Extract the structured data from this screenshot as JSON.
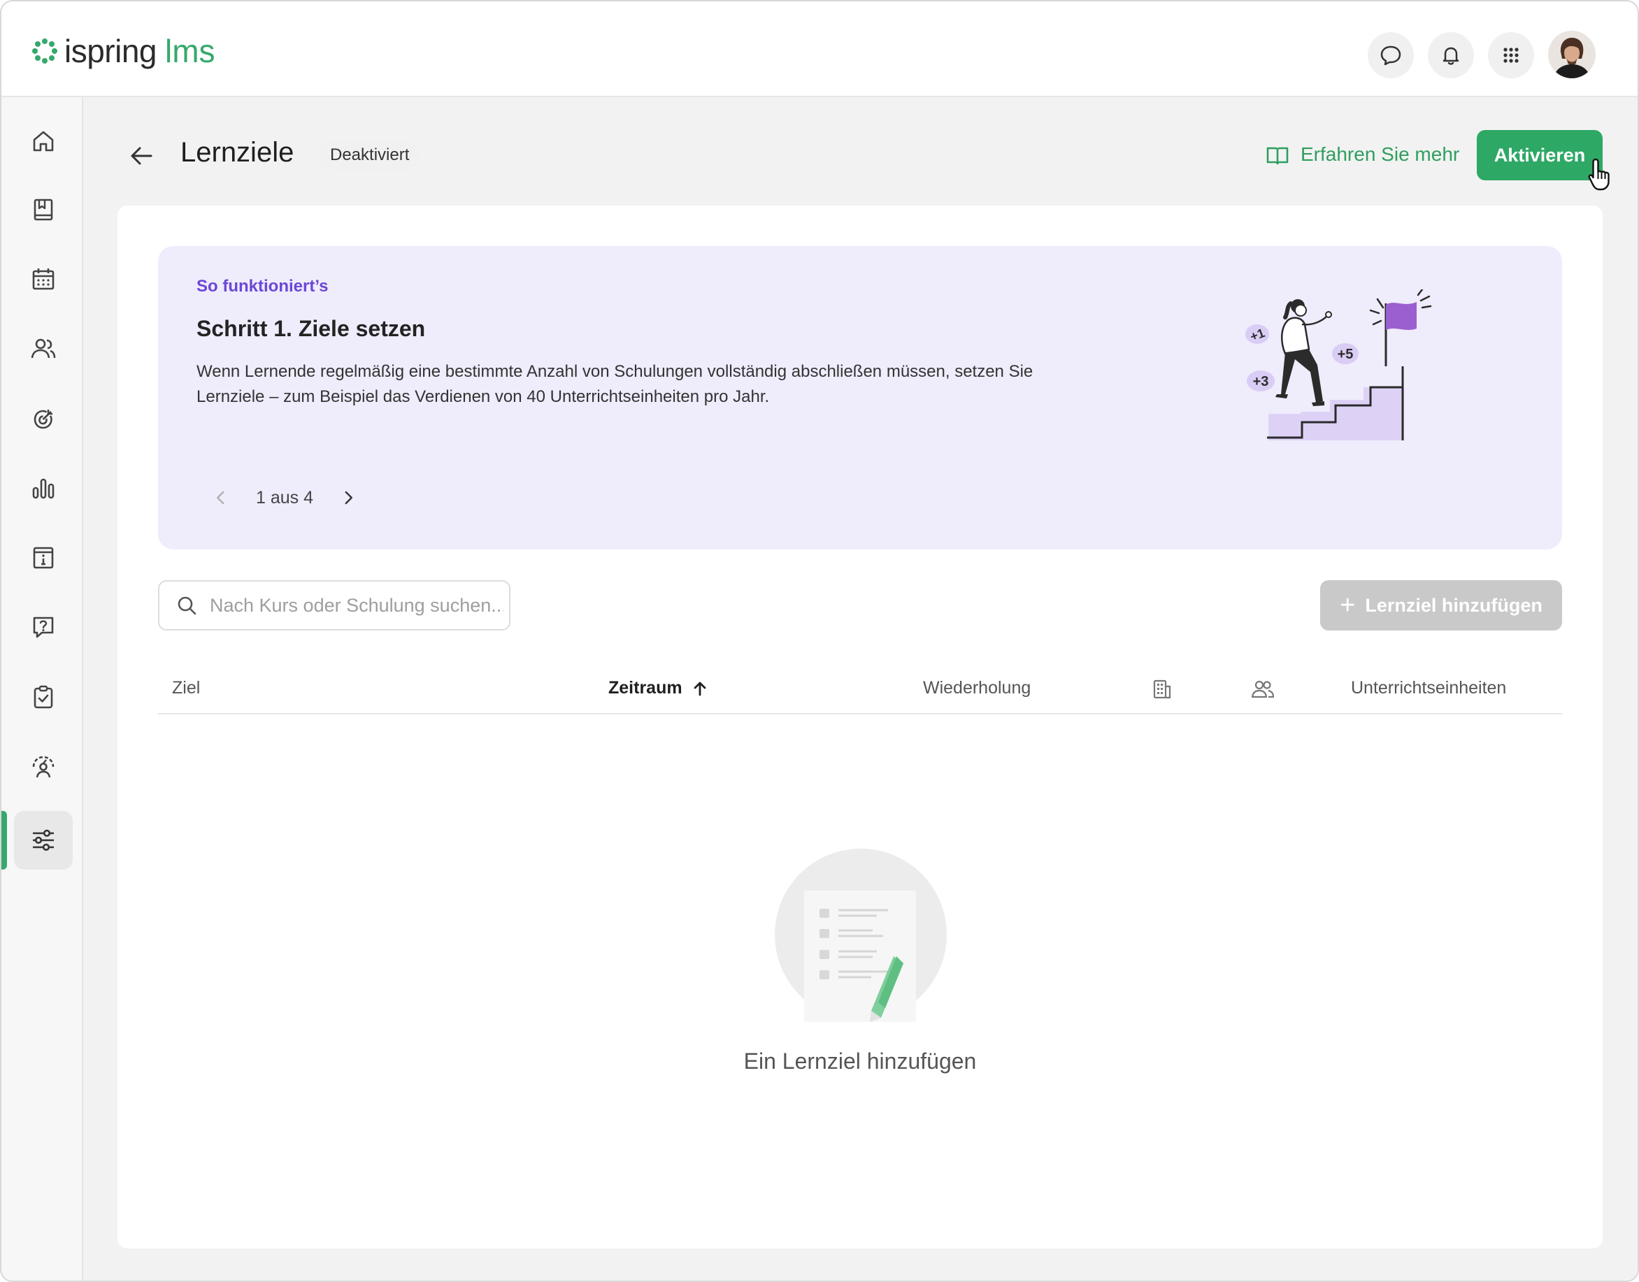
{
  "header": {
    "logo_text": "ispring",
    "logo_suffix": "lms",
    "icons": [
      "chat-icon",
      "bell-icon",
      "apps-grid-icon",
      "user-avatar"
    ]
  },
  "sidebar": {
    "items": [
      {
        "name": "home",
        "icon": "home-icon",
        "active": false
      },
      {
        "name": "learning",
        "icon": "book-icon",
        "active": false
      },
      {
        "name": "calendar",
        "icon": "calendar-icon",
        "active": false
      },
      {
        "name": "users",
        "icon": "users-icon",
        "active": false
      },
      {
        "name": "goals",
        "icon": "target-icon",
        "active": false
      },
      {
        "name": "reports",
        "icon": "bar-chart-icon",
        "active": false
      },
      {
        "name": "info",
        "icon": "info-icon",
        "active": false
      },
      {
        "name": "help",
        "icon": "question-icon",
        "active": false
      },
      {
        "name": "tasks",
        "icon": "clipboard-check-icon",
        "active": false
      },
      {
        "name": "performance",
        "icon": "gauge-user-icon",
        "active": false
      },
      {
        "name": "settings",
        "icon": "sliders-icon",
        "active": true
      }
    ]
  },
  "page": {
    "title": "Lernziele",
    "status": "Deaktiviert",
    "learn_more": "Erfahren Sie mehr",
    "activate_label": "Aktivieren"
  },
  "howto": {
    "kicker": "So funktioniert’s",
    "title": "Schritt 1. Ziele setzen",
    "text": "Wenn Lernende regelmäßig eine bestimmte Anzahl von Schulungen vollständig abschließen müssen, setzen Sie Lernziele – zum Beispiel das Verdienen von 40 Unterrichtseinheiten pro Jahr.",
    "pager": "1 aus 4",
    "badges": [
      "+1",
      "+5",
      "+3"
    ]
  },
  "search": {
    "placeholder": "Nach Kurs oder Schulung suchen..."
  },
  "add_button": "Lernziel hinzufügen",
  "table": {
    "columns": [
      "Ziel",
      "Zeitraum",
      "Wiederholung",
      "Unterrichtseinheiten"
    ],
    "sorted_column": "Zeitraum",
    "sort_direction": "ascending",
    "icon_columns": [
      "building-icon",
      "users-icon"
    ]
  },
  "empty_state": {
    "text": "Ein Lernziel hinzufügen"
  },
  "colors": {
    "brand_green": "#2ea865",
    "howto_bg": "#efecfc",
    "howto_accent": "#6b47d6",
    "flag_purple": "#9b5fcf",
    "disabled_button": "#c9c9c9"
  }
}
